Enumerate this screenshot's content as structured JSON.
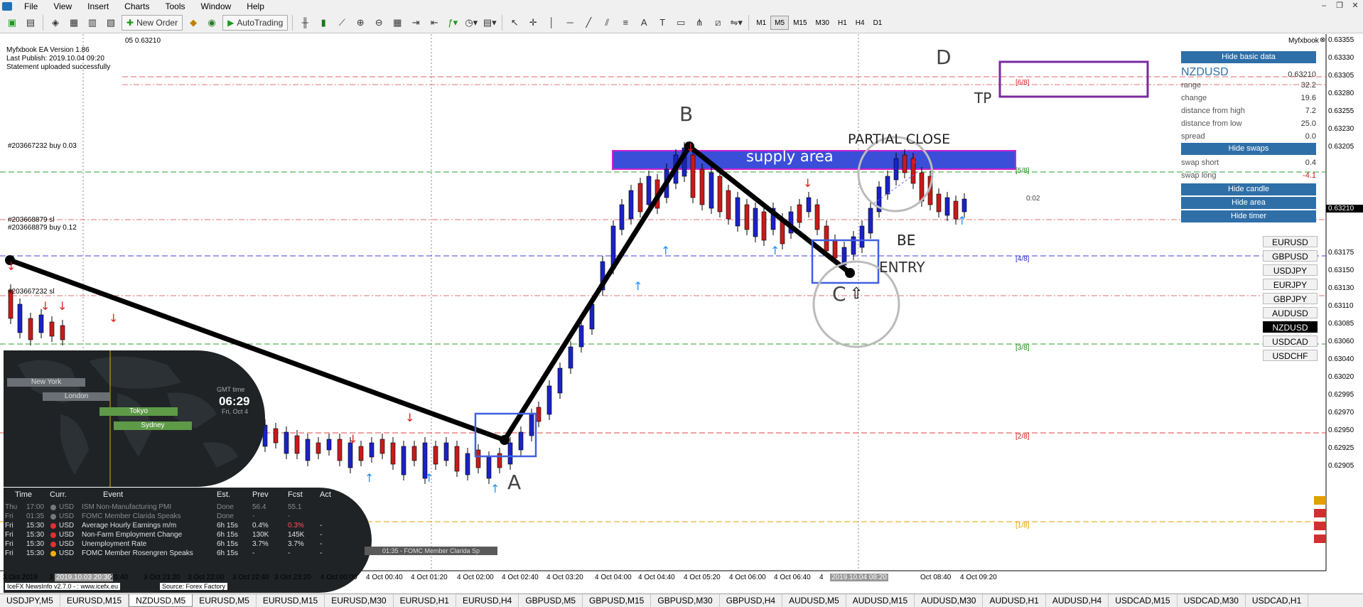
{
  "menu": {
    "items": [
      "File",
      "View",
      "Insert",
      "Charts",
      "Tools",
      "Window",
      "Help"
    ]
  },
  "toolbar": {
    "new_order": "New Order",
    "autotrading": "AutoTrading",
    "timeframes": [
      "M1",
      "M5",
      "M15",
      "M30",
      "H1",
      "H4",
      "D1"
    ],
    "active_timeframe": "M5"
  },
  "chart": {
    "top_label": "05 0.63210",
    "ea_lines": [
      "Myfxbook EA Version 1.86",
      "Last Publish: 2019.10.04 09:20",
      "Statement uploaded successfully"
    ],
    "myfxbook_label": "Myfxbook",
    "prices": [
      "0.63355",
      "0.63330",
      "0.63305",
      "0.63280",
      "0.63255",
      "0.63230",
      "0.63205",
      "0.63175",
      "0.63150",
      "0.63130",
      "0.63110",
      "0.63085",
      "0.63060",
      "0.63040",
      "0.63020",
      "0.62995",
      "0.62970",
      "0.62950",
      "0.62925",
      "0.62905"
    ],
    "current_price": "0.63210",
    "times": [
      "3 Oct 2019",
      "3",
      "2019.10.03 20:30",
      "20:40",
      "3 Oct 21:20",
      "3 Oct 22:00",
      "3 Oct 22:40",
      "3 Oct 23:20",
      "4 Oct 00:00",
      "4 Oct 00:40",
      "4 Oct 01:20",
      "4 Oct 02:00",
      "4 Oct 02:40",
      "4 Oct 03:20",
      "4 Oct 04:00",
      "4 Oct 04:40",
      "4 Oct 05:20",
      "4 Oct 06:00",
      "4 Oct 06:40",
      "4",
      "2019.10.04 08:20",
      "Oct 08:40",
      "4 Oct 09:20"
    ],
    "order_labels": [
      "#203667232 buy 0.03",
      "#203668879 sl",
      "#203668879 buy 0.12",
      "#203667232 sl"
    ],
    "octave_labels": [
      "[6/8]",
      "[5/8]",
      "[4/8]",
      "[3/8]",
      "[2/8]",
      "[1/8]"
    ],
    "timer": "0:02",
    "fomc_label": "01:35 - FOMC Member Clarida Sp",
    "annotations": {
      "a": "A",
      "b": "B",
      "c": "C",
      "d": "D",
      "tp": "TP",
      "be": "BE",
      "entry": "ENTRY",
      "partial_close": "PARTIAL CLOSE",
      "supply": "supply area"
    }
  },
  "panel": {
    "hide_basic": "Hide basic data",
    "symbol": "NZDUSD",
    "price": "0.63210",
    "rows": [
      {
        "label": "range",
        "value": "32.2"
      },
      {
        "label": "change",
        "value": "19.6"
      },
      {
        "label": "distance from high",
        "value": "7.2"
      },
      {
        "label": "distance from low",
        "value": "25.0"
      },
      {
        "label": "spread",
        "value": "0.0"
      }
    ],
    "hide_swaps": "Hide swaps",
    "swaps": [
      {
        "label": "swap short",
        "value": "0.4"
      },
      {
        "label": "swap long",
        "value": "-4.1"
      }
    ],
    "hide_candle": "Hide candle",
    "hide_area": "Hide area",
    "hide_timer": "Hide timer"
  },
  "symbols": [
    "EURUSD",
    "GBPUSD",
    "USDJPY",
    "EURJPY",
    "GBPJPY",
    "AUDUSD",
    "NZDUSD",
    "USDCAD",
    "USDCHF"
  ],
  "active_symbol": "NZDUSD",
  "world": {
    "sessions": [
      "New York",
      "London",
      "Tokyo",
      "Sydney"
    ],
    "gmt_label": "GMT time",
    "gmt_time": "06:29",
    "gmt_date": "Fri, Oct 4"
  },
  "news": {
    "headers": [
      "Time",
      "Curr.",
      "Event",
      "Est.",
      "Prev",
      "Fcst",
      "Act"
    ],
    "rows": [
      {
        "day": "Thu",
        "time": "17:00",
        "cur": "USD",
        "event": "ISM Non-Manufacturing PMI",
        "est": "Done",
        "prev": "56.4",
        "fcst": "55.1",
        "act": "",
        "state": "past",
        "impact": "#777777"
      },
      {
        "day": "Fri",
        "time": "01:35",
        "cur": "USD",
        "event": "FOMC Member Clarida Speaks",
        "est": "Done",
        "prev": "-",
        "fcst": "-",
        "act": "",
        "state": "past",
        "impact": "#777777"
      },
      {
        "day": "Fri",
        "time": "15:30",
        "cur": "USD",
        "event": "Average Hourly Earnings m/m",
        "est": "6h 15s",
        "prev": "0.4%",
        "fcst": "0.3%",
        "act": "-",
        "state": "up",
        "impact": "#e03030"
      },
      {
        "day": "Fri",
        "time": "15:30",
        "cur": "USD",
        "event": "Non-Farm Employment Change",
        "est": "6h 15s",
        "prev": "130K",
        "fcst": "145K",
        "act": "-",
        "state": "up",
        "impact": "#e03030"
      },
      {
        "day": "Fri",
        "time": "15:30",
        "cur": "USD",
        "event": "Unemployment Rate",
        "est": "6h 15s",
        "prev": "3.7%",
        "fcst": "3.7%",
        "act": "-",
        "state": "up",
        "impact": "#e03030"
      },
      {
        "day": "Fri",
        "time": "15:30",
        "cur": "USD",
        "event": "FOMC Member Rosengren Speaks",
        "est": "6h 15s",
        "prev": "-",
        "fcst": "-",
        "act": "-",
        "state": "up",
        "impact": "#f0b000"
      }
    ],
    "footer_left": "IceFX NewsInfo v2.7.0 - : www.icefx.eu",
    "footer_right": "Source: Forex Factory"
  },
  "tabs": [
    "USDJPY,M5",
    "EURUSD,M15",
    "NZDUSD,M5",
    "EURUSD,M5",
    "EURUSD,M15",
    "EURUSD,M30",
    "EURUSD,H1",
    "EURUSD,H4",
    "GBPUSD,M5",
    "GBPUSD,M15",
    "GBPUSD,M30",
    "GBPUSD,H4",
    "AUDUSD,M5",
    "AUDUSD,M15",
    "AUDUSD,M30",
    "AUDUSD,H1",
    "AUDUSD,H4",
    "USDCAD,M15",
    "USDCAD,M30",
    "USDCAD,H1"
  ],
  "active_tab": "NZDUSD,M5",
  "colors": {
    "bull": "#1a22c8",
    "bear": "#c81a1a",
    "supply": "#3a4ed8",
    "supply_border": "#d020d0",
    "tp_box": "#7a2aa0",
    "panel_btn": "#2f6fa8"
  }
}
